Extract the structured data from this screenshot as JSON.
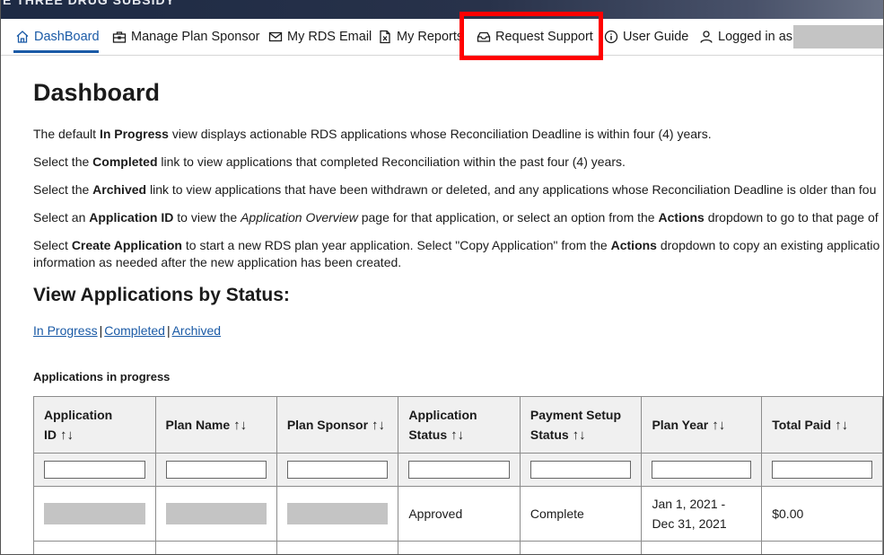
{
  "header": {
    "title": "E THREE DRUG SUBSIDY"
  },
  "nav": {
    "dashboard": "DashBoard",
    "manage_plan_sponsor": "Manage Plan Sponsor",
    "my_rds_email": "My RDS Email",
    "my_reports": "My Reports",
    "request_support": "Request Support",
    "user_guide": "User Guide",
    "logged_in_as": "Logged in as"
  },
  "page": {
    "title": "Dashboard",
    "p1": {
      "a": "The default ",
      "b": "In Progress",
      "c": " view displays actionable RDS applications whose Reconciliation Deadline is within four (4) years."
    },
    "p2": {
      "a": "Select the ",
      "b": "Completed",
      "c": " link to view applications that completed Reconciliation within the past four (4) years."
    },
    "p3": {
      "a": "Select the ",
      "b": "Archived",
      "c": " link to view applications that have been withdrawn or deleted, and any applications whose Reconciliation Deadline is older than fou"
    },
    "p4": {
      "a": "Select an ",
      "b": "Application ID",
      "c": " to view the ",
      "d": "Application Overview",
      "e": " page for that application, or select an option from the ",
      "f": "Actions",
      "g": " dropdown to go to that page of"
    },
    "p5": {
      "a": "Select ",
      "b": "Create Application",
      "c": " to start a new RDS plan year application. Select \"Copy Application\" from the ",
      "d": "Actions",
      "e": " dropdown to copy an existing applicatio",
      "line2": "information as needed after the new application has been created."
    },
    "status_heading": "View Applications by Status:",
    "links": {
      "in_progress": "In Progress",
      "completed": "Completed",
      "archived": "Archived",
      "sep": "|"
    },
    "table_caption": "Applications in progress"
  },
  "table": {
    "headers": {
      "app_id": "Application ID",
      "plan_name": "Plan Name",
      "plan_sponsor": "Plan Sponsor",
      "app_status_1": "Application",
      "app_status_2": "Status",
      "pay_status_1": "Payment Setup",
      "pay_status_2": "Status",
      "plan_year": "Plan Year",
      "total_paid": "Total Paid"
    },
    "sort_icon": "sort-arrows-icon",
    "row1": {
      "app_status": "Approved",
      "payment_status": "Complete",
      "plan_year_1": "Jan 1, 2021 -",
      "plan_year_2": "Dec 31, 2021",
      "total_paid": "$0.00"
    }
  },
  "colors": {
    "accent": "#1a5aa6",
    "highlight": "#ff0000"
  }
}
